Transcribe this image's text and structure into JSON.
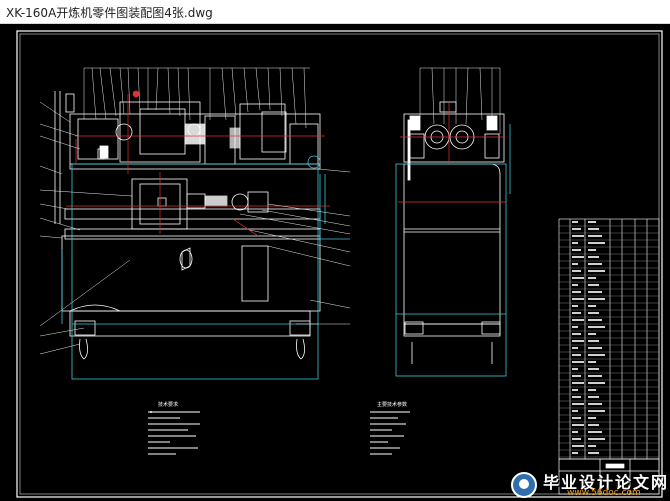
{
  "window": {
    "title": "XK-160A开炼机零件图装配图4张.dwg"
  },
  "drawing": {
    "colors": {
      "background": "#000000",
      "frame": "#ffffff",
      "machine": "#ffffff",
      "leader": "#e8e8e8",
      "centerline": "#e03030",
      "hidden": "#3fc7d8",
      "accent": "#e03030"
    },
    "notes_left_title": "技术要求",
    "notes_right_title": "主要技术参数"
  },
  "watermark": {
    "name": "毕业设计论文网",
    "url": "www.56doc.com",
    "icon": "doc-logo-icon"
  }
}
